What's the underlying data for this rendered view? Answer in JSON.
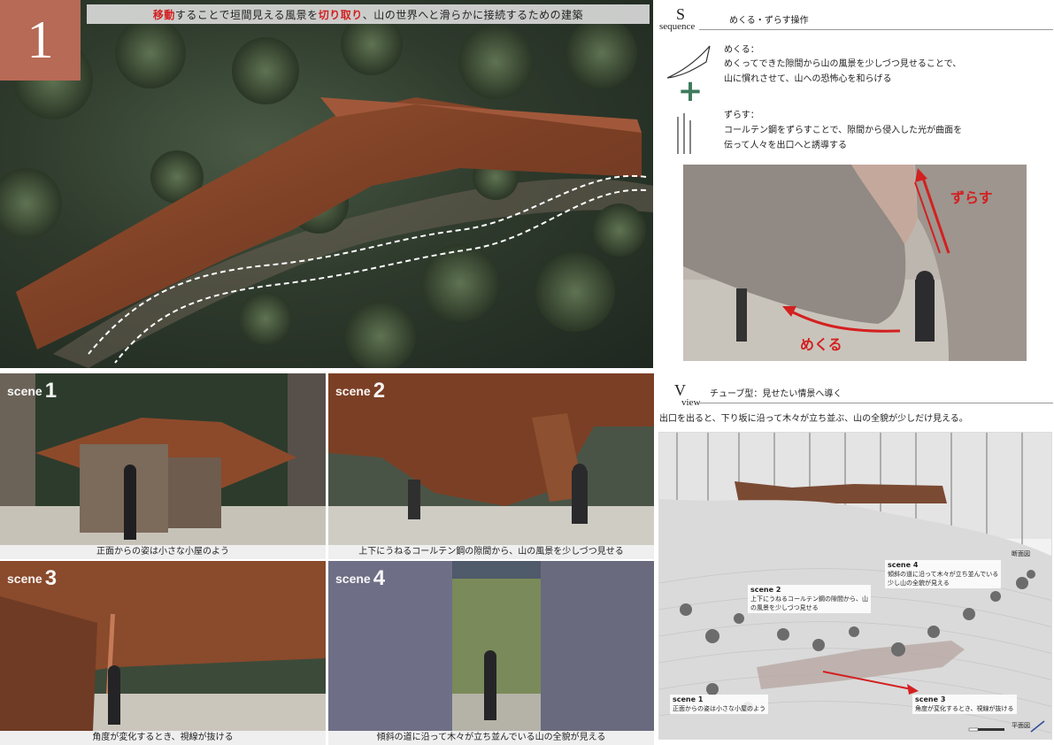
{
  "page": {
    "number": "1",
    "title_parts": [
      {
        "text": "移動",
        "emph": true
      },
      {
        "text": "することで垣間見える風景を",
        "emph": false
      },
      {
        "text": "切り取り",
        "emph": true
      },
      {
        "text": "、山の世界へと滑らかに接続するための建築",
        "emph": false
      }
    ]
  },
  "sequence": {
    "letter": "S",
    "word": "sequence",
    "heading": "めくる・ずらす操作",
    "mekuru": {
      "label": "めくる：",
      "line1": "めくってできた隙間から山の風景を少しづつ見せることで、",
      "line2": "山に慣れさせて、山への恐怖心を和らげる"
    },
    "plus": "+",
    "zurasu": {
      "label": "ずらす：",
      "line1": "コールテン鋼をずらすことで、隙間から侵入した光が曲面を",
      "line2": "伝って人々を出口へと誘導する"
    },
    "photo_labels": {
      "zurasu": "ずらす",
      "mekuru": "めくる"
    }
  },
  "view": {
    "letter": "V",
    "word": "view",
    "heading": "チューブ型：見せたい情景へ導く",
    "description": "出口を出ると、下り坂に沿って木々が立ち並ぶ、山の全貌が少しだけ見える。",
    "plan_notes": {
      "scene1": {
        "title": "scene 1",
        "text": "正面からの姿は小さな小屋のよう"
      },
      "scene2": {
        "title": "scene 2",
        "text1": "上下にうねるコールテン鋼の隙間から、山",
        "text2": "の風景を少しづつ見せる"
      },
      "scene3": {
        "title": "scene 3",
        "text": "角度が変化するとき、視線が抜ける"
      },
      "scene4": {
        "title": "scene 4",
        "text1": "傾斜の道に沿って木々が立ち並んでいる",
        "text2": "少し山の全貌が見える"
      },
      "section_label": "断面図",
      "plan_label": "平面図"
    }
  },
  "scenes": [
    {
      "word": "scene",
      "num": "1",
      "caption": "正面からの姿は小さな小屋のよう"
    },
    {
      "word": "scene",
      "num": "2",
      "caption": "上下にうねるコールテン鋼の隙間から、山の風景を少しづつ見せる"
    },
    {
      "word": "scene",
      "num": "3",
      "caption": "角度が変化するとき、視線が抜ける"
    },
    {
      "word": "scene",
      "num": "4",
      "caption": "傾斜の道に沿って木々が立ち並んでいる山の全貌が見える"
    }
  ],
  "colors": {
    "accent": "#b76a55",
    "corten": "#8a4a2c",
    "highlight_red": "#d32020",
    "plus_green": "#3e7a5c"
  }
}
